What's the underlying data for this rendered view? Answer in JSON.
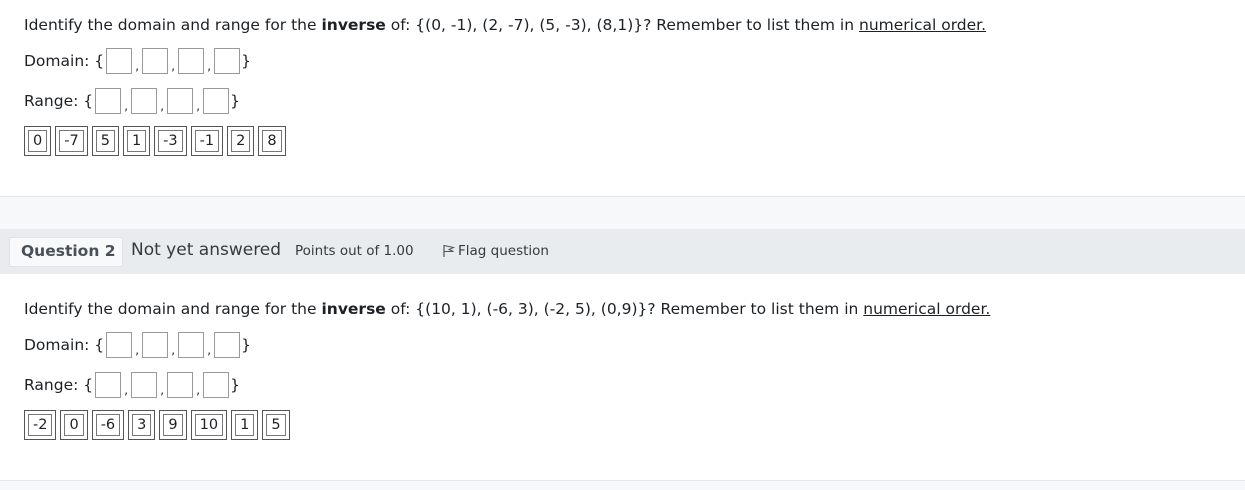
{
  "questions": [
    {
      "prompt_before": "Identify the domain and range for the ",
      "prompt_bold": "inverse",
      "prompt_after": " of: {(0, -1), (2, -7), (5, -3), (8,1)}? Remember to list them in ",
      "prompt_link": "numerical order.",
      "domain_label": "Domain: {",
      "range_label": "Range: {",
      "close_brace": "}",
      "comma": ",",
      "choices": [
        "0",
        "-7",
        "5",
        "1",
        "-3",
        "-1",
        "2",
        "8"
      ]
    },
    {
      "number_label": "Question 2",
      "state": "Not yet answered",
      "grade": "Points out of 1.00",
      "flag_label": "Flag question",
      "prompt_before": "Identify the domain and range for the ",
      "prompt_bold": "inverse",
      "prompt_after": " of: {(10, 1), (-6, 3), (-2, 5), (0,9)}? Remember to list them in ",
      "prompt_link": "numerical order.",
      "domain_label": "Domain: {",
      "range_label": "Range: {",
      "close_brace": "}",
      "comma": ",",
      "choices": [
        "-2",
        "0",
        "-6",
        "3",
        "9",
        "10",
        "1",
        "5"
      ]
    }
  ],
  "icons": {
    "flag": "flag-icon"
  },
  "colors": {
    "header_bg": "#e9ecef",
    "gap_bg": "#f7f8f9",
    "text": "#1d2125"
  }
}
